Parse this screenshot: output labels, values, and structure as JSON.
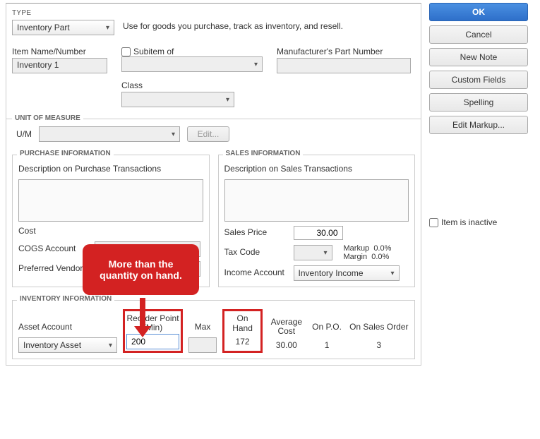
{
  "type_section": {
    "label": "TYPE",
    "value": "Inventory Part",
    "description": "Use for goods you purchase, track as inventory, and resell."
  },
  "item": {
    "name_label": "Item Name/Number",
    "name_value": "Inventory 1",
    "subitem_label": "Subitem of",
    "class_label": "Class",
    "mfr_label": "Manufacturer's Part Number"
  },
  "uom": {
    "section": "UNIT OF MEASURE",
    "label": "U/M",
    "edit": "Edit..."
  },
  "purchase": {
    "section": "PURCHASE INFORMATION",
    "desc_label": "Description on Purchase Transactions",
    "cost_label": "Cost",
    "cogs_label": "COGS Account",
    "vendor_label": "Preferred Vendor"
  },
  "sales": {
    "section": "SALES INFORMATION",
    "desc_label": "Description on Sales Transactions",
    "price_label": "Sales Price",
    "price_value": "30.00",
    "tax_label": "Tax Code",
    "income_label": "Income Account",
    "income_value": "Inventory Income",
    "markup_label": "Markup",
    "markup_value": "0.0%",
    "margin_label": "Margin",
    "margin_value": "0.0%"
  },
  "inventory": {
    "section": "INVENTORY INFORMATION",
    "asset_label": "Asset Account",
    "asset_value": "Inventory Asset",
    "reorder_label": "Reorder Point (Min)",
    "reorder_value": "200",
    "max_label": "Max",
    "onhand_label": "On Hand",
    "onhand_value": "172",
    "avgcost_label": "Average Cost",
    "avgcost_value": "30.00",
    "onpo_label": "On P.O.",
    "onpo_value": "1",
    "onso_label": "On Sales Order",
    "onso_value": "3"
  },
  "side": {
    "ok": "OK",
    "cancel": "Cancel",
    "newnote": "New Note",
    "custom": "Custom Fields",
    "spelling": "Spelling",
    "markup": "Edit Markup..."
  },
  "inactive_label": "Item is inactive",
  "callout_text": "More than the quantity on hand."
}
